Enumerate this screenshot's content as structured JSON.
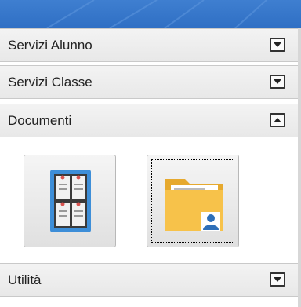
{
  "accordion": {
    "sections": [
      {
        "label": "Servizi Alunno",
        "state": "collapsed",
        "toggle_icon": "expand-icon"
      },
      {
        "label": "Servizi Classe",
        "state": "collapsed",
        "toggle_icon": "expand-icon"
      },
      {
        "label": "Documenti",
        "state": "expanded",
        "toggle_icon": "collapse-icon"
      },
      {
        "label": "Utilità",
        "state": "collapsed",
        "toggle_icon": "expand-icon"
      }
    ]
  },
  "documenti": {
    "items": [
      {
        "icon": "bulletin-board-icon",
        "focused": false
      },
      {
        "icon": "user-folder-icon",
        "focused": true
      }
    ]
  },
  "colors": {
    "banner": "#2f6fc4",
    "header_bg": "#ececec",
    "board_frame": "#3d8ed8",
    "folder": "#f7c24a"
  }
}
